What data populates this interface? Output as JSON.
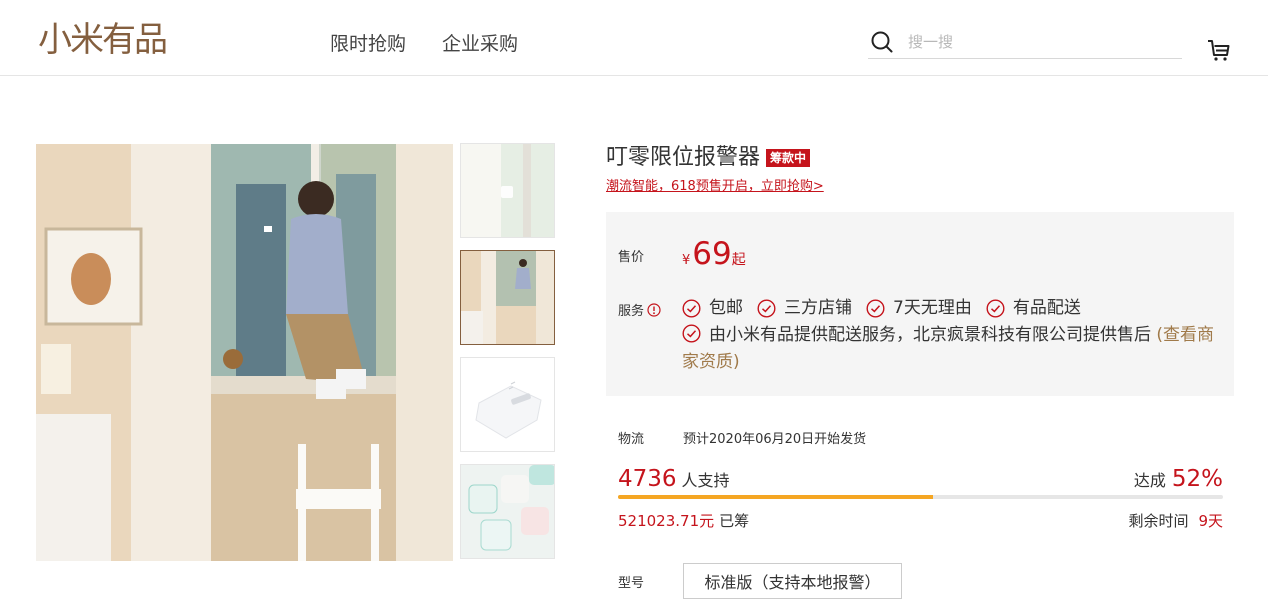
{
  "header": {
    "logo": "小米有品",
    "nav": [
      "限时抢购",
      "企业采购"
    ],
    "search_placeholder": "搜一搜"
  },
  "product": {
    "title": "叮零限位报警器",
    "badge": "筹款中",
    "promo": "潮流智能，618预售开启，立即抢购>",
    "price_label": "售价",
    "currency": "¥",
    "price": "69",
    "price_suffix": "起",
    "service_label": "服务",
    "services": [
      "包邮",
      "三方店铺",
      "7天无理由",
      "有品配送"
    ],
    "service_note": "由小米有品提供配送服务，北京疯景科技有限公司提供售后",
    "service_link": "(查看商家资质)",
    "logistics_label": "物流",
    "logistics_text": "预计2020年06月20日开始发货"
  },
  "crowdfunding": {
    "supporters": "4736",
    "supporters_text": "人支持",
    "achieved_text": "达成",
    "achieved_pct": "52%",
    "progress": 0.52,
    "raised": "521023.71元",
    "raised_text": "已筹",
    "remaining_text": "剩余时间",
    "remaining": "9天"
  },
  "model": {
    "label": "型号",
    "option": "标准版（支持本地报警）"
  },
  "colors": {
    "brand": "#845f3f",
    "accent_red": "#c5141c",
    "progress": "#f5a623"
  }
}
